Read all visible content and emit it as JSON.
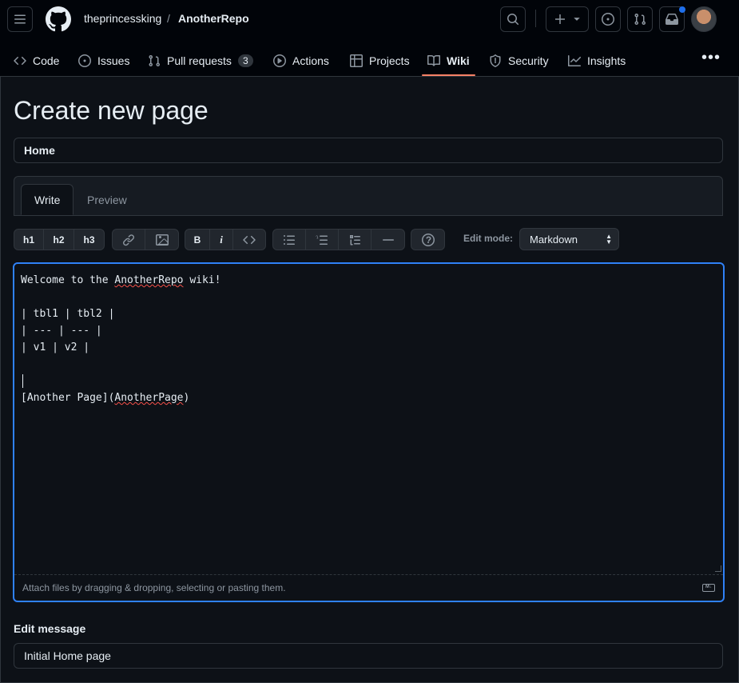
{
  "header": {
    "owner": "theprincessking",
    "separator": "/",
    "repo": "AnotherRepo",
    "icons": [
      "menu-icon",
      "github-logo-icon",
      "search-icon",
      "plus-icon",
      "issue-icon",
      "pull-request-icon",
      "inbox-icon"
    ],
    "notification_color": "#1f6feb"
  },
  "nav": {
    "items": [
      {
        "label": "Code",
        "icon": "code-icon"
      },
      {
        "label": "Issues",
        "icon": "issue-icon"
      },
      {
        "label": "Pull requests",
        "icon": "pull-request-icon",
        "count": "3"
      },
      {
        "label": "Actions",
        "icon": "play-icon"
      },
      {
        "label": "Projects",
        "icon": "table-icon"
      },
      {
        "label": "Wiki",
        "icon": "book-icon",
        "active": true
      },
      {
        "label": "Security",
        "icon": "shield-icon"
      },
      {
        "label": "Insights",
        "icon": "graph-icon"
      }
    ],
    "more": "•••",
    "active_color": "#f78166"
  },
  "page": {
    "title": "Create new page",
    "page_name_value": "Home"
  },
  "editor": {
    "tabs": {
      "write": "Write",
      "preview": "Preview"
    },
    "toolbar": {
      "h1": "h1",
      "h2": "h2",
      "h3": "h3",
      "bold": "B",
      "italic": "i"
    },
    "edit_mode_label": "Edit mode:",
    "edit_mode_value": "Markdown",
    "content": {
      "line1_a": "Welcome to the ",
      "line1_b": "AnotherRepo",
      "line1_c": " wiki!",
      "line3": "| tbl1 | tbl2 |",
      "line4": "| --- | --- |",
      "line5": "| v1 | v2 |",
      "line8_a": "[Another Page](",
      "line8_b": "AnotherPage",
      "line8_c": ")"
    },
    "attach_hint": "Attach files by dragging & dropping, selecting or pasting them.",
    "md_badge": "M↓",
    "focus_color": "#2f81f7"
  },
  "message": {
    "label": "Edit message",
    "value": "Initial Home page"
  }
}
